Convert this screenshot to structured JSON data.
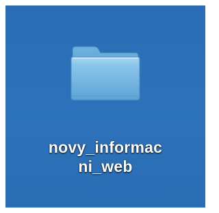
{
  "desktop": {
    "background_color": "#2a6eb5",
    "items": [
      {
        "type": "folder",
        "icon": "folder-icon",
        "label_lines": [
          "novy_informac",
          "ni_web"
        ]
      }
    ]
  }
}
